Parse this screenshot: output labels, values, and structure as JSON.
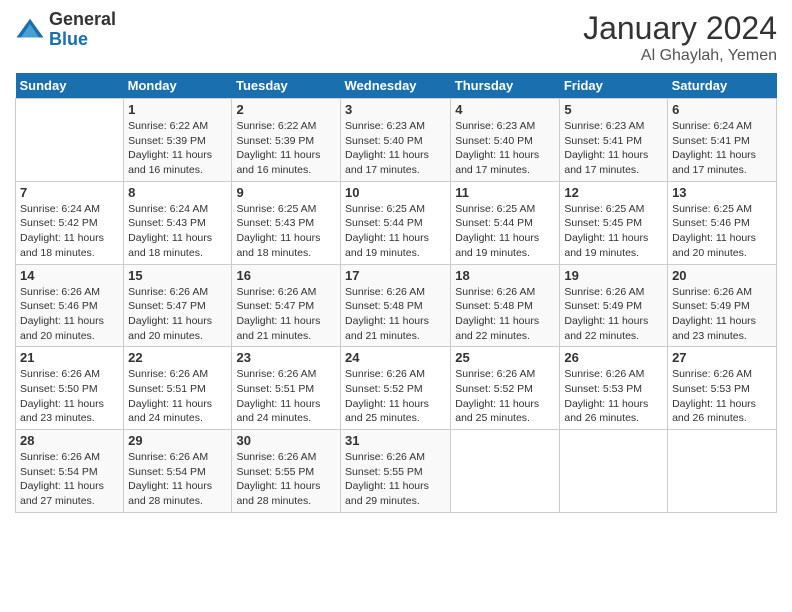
{
  "header": {
    "logo_general": "General",
    "logo_blue": "Blue",
    "month_title": "January 2024",
    "subtitle": "Al Ghaylah, Yemen"
  },
  "weekdays": [
    "Sunday",
    "Monday",
    "Tuesday",
    "Wednesday",
    "Thursday",
    "Friday",
    "Saturday"
  ],
  "weeks": [
    [
      {
        "day": "",
        "info": ""
      },
      {
        "day": "1",
        "info": "Sunrise: 6:22 AM\nSunset: 5:39 PM\nDaylight: 11 hours and 16 minutes."
      },
      {
        "day": "2",
        "info": "Sunrise: 6:22 AM\nSunset: 5:39 PM\nDaylight: 11 hours and 16 minutes."
      },
      {
        "day": "3",
        "info": "Sunrise: 6:23 AM\nSunset: 5:40 PM\nDaylight: 11 hours and 17 minutes."
      },
      {
        "day": "4",
        "info": "Sunrise: 6:23 AM\nSunset: 5:40 PM\nDaylight: 11 hours and 17 minutes."
      },
      {
        "day": "5",
        "info": "Sunrise: 6:23 AM\nSunset: 5:41 PM\nDaylight: 11 hours and 17 minutes."
      },
      {
        "day": "6",
        "info": "Sunrise: 6:24 AM\nSunset: 5:41 PM\nDaylight: 11 hours and 17 minutes."
      }
    ],
    [
      {
        "day": "7",
        "info": "Sunrise: 6:24 AM\nSunset: 5:42 PM\nDaylight: 11 hours and 18 minutes."
      },
      {
        "day": "8",
        "info": "Sunrise: 6:24 AM\nSunset: 5:43 PM\nDaylight: 11 hours and 18 minutes."
      },
      {
        "day": "9",
        "info": "Sunrise: 6:25 AM\nSunset: 5:43 PM\nDaylight: 11 hours and 18 minutes."
      },
      {
        "day": "10",
        "info": "Sunrise: 6:25 AM\nSunset: 5:44 PM\nDaylight: 11 hours and 19 minutes."
      },
      {
        "day": "11",
        "info": "Sunrise: 6:25 AM\nSunset: 5:44 PM\nDaylight: 11 hours and 19 minutes."
      },
      {
        "day": "12",
        "info": "Sunrise: 6:25 AM\nSunset: 5:45 PM\nDaylight: 11 hours and 19 minutes."
      },
      {
        "day": "13",
        "info": "Sunrise: 6:25 AM\nSunset: 5:46 PM\nDaylight: 11 hours and 20 minutes."
      }
    ],
    [
      {
        "day": "14",
        "info": "Sunrise: 6:26 AM\nSunset: 5:46 PM\nDaylight: 11 hours and 20 minutes."
      },
      {
        "day": "15",
        "info": "Sunrise: 6:26 AM\nSunset: 5:47 PM\nDaylight: 11 hours and 20 minutes."
      },
      {
        "day": "16",
        "info": "Sunrise: 6:26 AM\nSunset: 5:47 PM\nDaylight: 11 hours and 21 minutes."
      },
      {
        "day": "17",
        "info": "Sunrise: 6:26 AM\nSunset: 5:48 PM\nDaylight: 11 hours and 21 minutes."
      },
      {
        "day": "18",
        "info": "Sunrise: 6:26 AM\nSunset: 5:48 PM\nDaylight: 11 hours and 22 minutes."
      },
      {
        "day": "19",
        "info": "Sunrise: 6:26 AM\nSunset: 5:49 PM\nDaylight: 11 hours and 22 minutes."
      },
      {
        "day": "20",
        "info": "Sunrise: 6:26 AM\nSunset: 5:49 PM\nDaylight: 11 hours and 23 minutes."
      }
    ],
    [
      {
        "day": "21",
        "info": "Sunrise: 6:26 AM\nSunset: 5:50 PM\nDaylight: 11 hours and 23 minutes."
      },
      {
        "day": "22",
        "info": "Sunrise: 6:26 AM\nSunset: 5:51 PM\nDaylight: 11 hours and 24 minutes."
      },
      {
        "day": "23",
        "info": "Sunrise: 6:26 AM\nSunset: 5:51 PM\nDaylight: 11 hours and 24 minutes."
      },
      {
        "day": "24",
        "info": "Sunrise: 6:26 AM\nSunset: 5:52 PM\nDaylight: 11 hours and 25 minutes."
      },
      {
        "day": "25",
        "info": "Sunrise: 6:26 AM\nSunset: 5:52 PM\nDaylight: 11 hours and 25 minutes."
      },
      {
        "day": "26",
        "info": "Sunrise: 6:26 AM\nSunset: 5:53 PM\nDaylight: 11 hours and 26 minutes."
      },
      {
        "day": "27",
        "info": "Sunrise: 6:26 AM\nSunset: 5:53 PM\nDaylight: 11 hours and 26 minutes."
      }
    ],
    [
      {
        "day": "28",
        "info": "Sunrise: 6:26 AM\nSunset: 5:54 PM\nDaylight: 11 hours and 27 minutes."
      },
      {
        "day": "29",
        "info": "Sunrise: 6:26 AM\nSunset: 5:54 PM\nDaylight: 11 hours and 28 minutes."
      },
      {
        "day": "30",
        "info": "Sunrise: 6:26 AM\nSunset: 5:55 PM\nDaylight: 11 hours and 28 minutes."
      },
      {
        "day": "31",
        "info": "Sunrise: 6:26 AM\nSunset: 5:55 PM\nDaylight: 11 hours and 29 minutes."
      },
      {
        "day": "",
        "info": ""
      },
      {
        "day": "",
        "info": ""
      },
      {
        "day": "",
        "info": ""
      }
    ]
  ]
}
